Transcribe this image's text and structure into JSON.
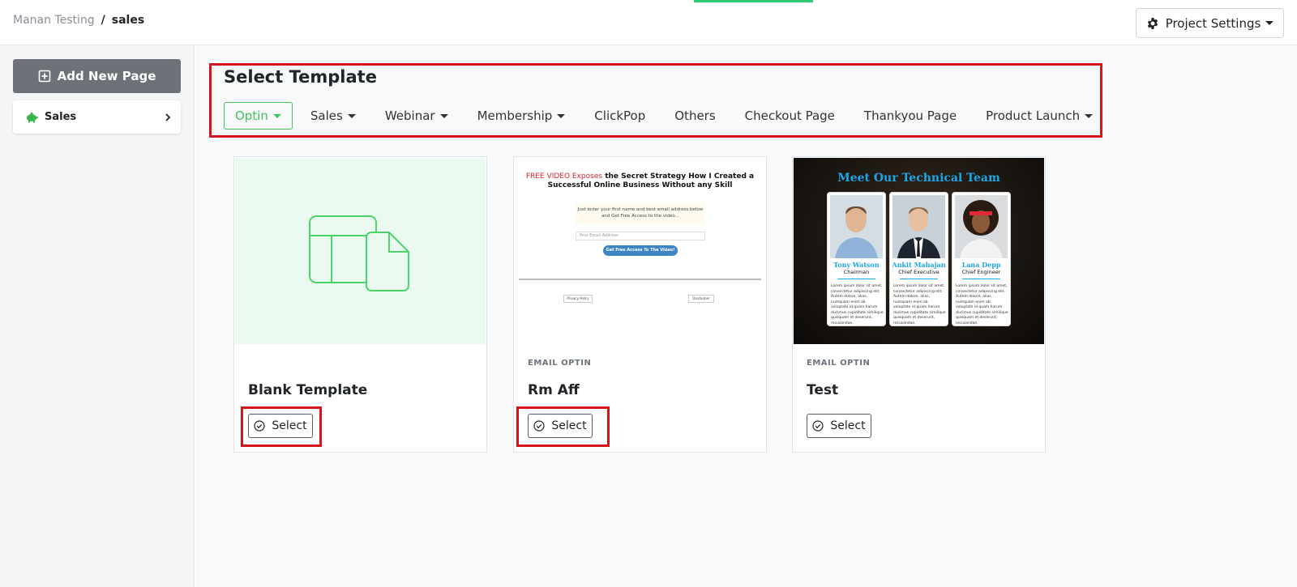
{
  "breadcrumb": {
    "parent": "Manan Testing",
    "separator": "/",
    "current": "sales"
  },
  "header": {
    "project_settings_label": "Project Settings"
  },
  "sidebar": {
    "add_page_label": "Add New Page",
    "items": [
      {
        "label": "Sales",
        "icon": "piggy-bank-icon"
      }
    ]
  },
  "main": {
    "title": "Select Template",
    "tabs": [
      {
        "label": "Optin",
        "active": true,
        "dropdown": true
      },
      {
        "label": "Sales",
        "dropdown": true
      },
      {
        "label": "Webinar",
        "dropdown": true
      },
      {
        "label": "Membership",
        "dropdown": true
      },
      {
        "label": "ClickPop",
        "dropdown": false
      },
      {
        "label": "Others",
        "dropdown": false
      },
      {
        "label": "Checkout Page",
        "dropdown": false
      },
      {
        "label": "Thankyou Page",
        "dropdown": false
      },
      {
        "label": "Product Launch",
        "dropdown": true
      }
    ],
    "templates": [
      {
        "category": "",
        "name": "Blank Template",
        "select_label": "Select"
      },
      {
        "category": "EMAIL OPTIN",
        "name": "Rm Aff",
        "select_label": "Select",
        "preview": {
          "headline_red": "FREE VIDEO Exposes",
          "headline_rest": "the Secret Strategy How I Created a Successful Online Business Without any Skill",
          "subtext": "Just enter your first name and best email address below and Get Free Access to the video...",
          "email_placeholder": "Your Email Address",
          "cta": "Get Free Access To The Video!",
          "footer_left": "Privacy Policy",
          "footer_right": "Disclaimer"
        }
      },
      {
        "category": "EMAIL OPTIN",
        "name": "Test",
        "select_label": "Select",
        "preview": {
          "title": "Meet Our Technical Team",
          "members": [
            {
              "name": "Tony Watson",
              "role": "Chairman"
            },
            {
              "name": "Ankit Mahajan",
              "role": "Chief Executive"
            },
            {
              "name": "Lana Depp",
              "role": "Chief Engineer"
            }
          ],
          "desc": "Lorem ipsum dolor sit amet, consectetur adipiscing elit. Autem dolore, alias, numquam enim ab voluptate id quam harum ducimus cupiditate similique quisquam et deserunt, recusandae."
        }
      }
    ]
  },
  "colors": {
    "accent_green": "#46c35a",
    "highlight_red": "#d4161c",
    "progress_green": "#2ecc71",
    "team_blue": "#1ea5e6"
  }
}
